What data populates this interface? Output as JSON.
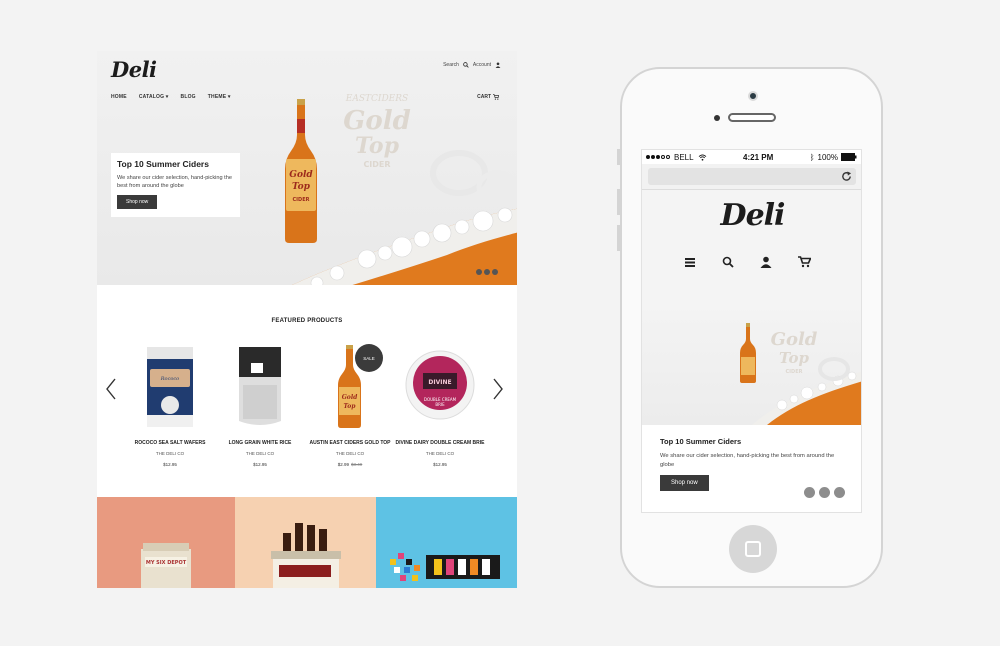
{
  "desktop": {
    "logo": "Deli",
    "search_label": "Search",
    "account_label": "Account",
    "nav": [
      "HOME",
      "CATALOG",
      "BLOG",
      "THEME"
    ],
    "cart_label": "CART",
    "hero": {
      "title": "Top 10 Summer Ciders",
      "description": "We share our cider selection, hand-picking the best from around the globe",
      "button": "Shop now",
      "slides": 3
    },
    "featured": {
      "heading": "FEATURED PRODUCTS",
      "products": [
        {
          "name": "ROCOCO SEA SALT WAFERS",
          "vendor": "THE DELI CO",
          "price": "$12.95"
        },
        {
          "name": "LONG GRAIN WHITE RICE",
          "vendor": "THE DELI CO",
          "price": "$12.95"
        },
        {
          "name": "AUSTIN EAST CIDERS GOLD TOP",
          "vendor": "THE DELI CO",
          "price": "$2.99",
          "old_price": "$3.49",
          "badge": "SALE"
        },
        {
          "name": "DIVINE DAIRY DOUBLE CREAM BRIE",
          "vendor": "THE DELI CO",
          "price": "$12.95"
        }
      ]
    },
    "tiles": [
      {
        "color": "#e89a80",
        "label": "MY SIX DEPOT"
      },
      {
        "color": "#f6d1b1",
        "label": ""
      },
      {
        "color": "#5ec2e4",
        "label": ""
      }
    ]
  },
  "mobile": {
    "carrier": "BELL",
    "time": "4:21 PM",
    "battery": "100%",
    "logo": "Deli",
    "hero": {
      "title": "Top 10 Summer Ciders",
      "description": "We share our cider selection, hand-picking the best from around the globe",
      "button": "Shop now"
    }
  },
  "colors": {
    "background": "#f3f3f3",
    "dark_button": "#3a3a3a",
    "cider_amber": "#e07a1e"
  }
}
